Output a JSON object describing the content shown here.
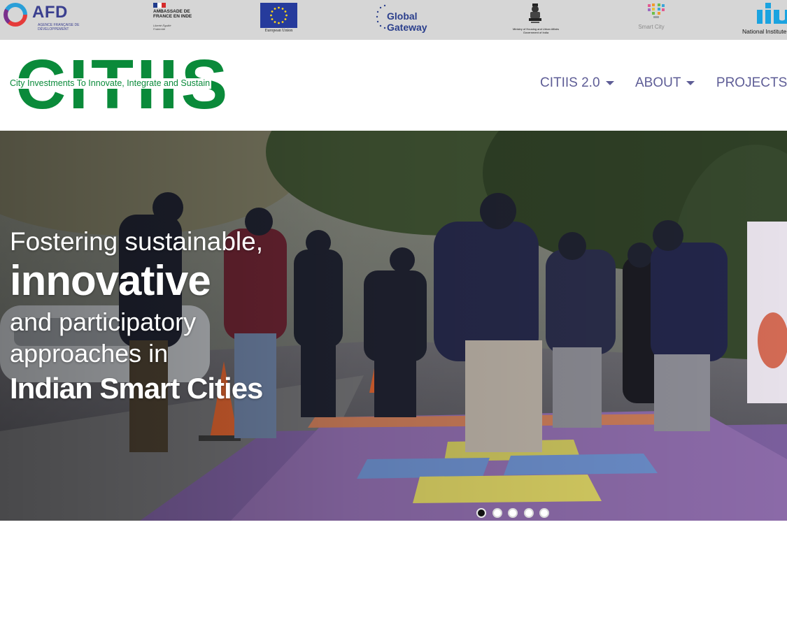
{
  "partners": {
    "afd": {
      "name": "AFD",
      "subtitle": "AGENCE FRANÇAISE DE DÉVELOPPEMENT"
    },
    "france": {
      "name": "AMBASSADE DE FRANCE EN INDE",
      "motto": "Liberté Égalité Fraternité"
    },
    "eu": {
      "caption": "European Union"
    },
    "global_gateway": {
      "name": "Global Gateway"
    },
    "ministry": {
      "name": "Ministry of Housing and Urban Affairs Government of India"
    },
    "smart_city": {
      "name": "Smart City"
    },
    "niua": {
      "name": "National Institute of"
    }
  },
  "brand": {
    "name": "CITIIS",
    "tagline": "City Investments To Innovate, Integrate and Sustain"
  },
  "nav": {
    "items": [
      {
        "label": "CITIIS 2.0",
        "dropdown": true
      },
      {
        "label": "ABOUT",
        "dropdown": true
      },
      {
        "label": "PROJECTS",
        "dropdown": false
      }
    ]
  },
  "hero": {
    "line1": "Fostering sustainable,",
    "line2": "innovative",
    "line3": "and participatory",
    "line4": "approaches in",
    "line5": "Indian Smart Cities",
    "slides_count": 5,
    "active_slide": 1
  },
  "colors": {
    "brand_green": "#0a8a3a",
    "nav_purple": "#5e5d96",
    "partner_strip": "#d6d6d6"
  }
}
